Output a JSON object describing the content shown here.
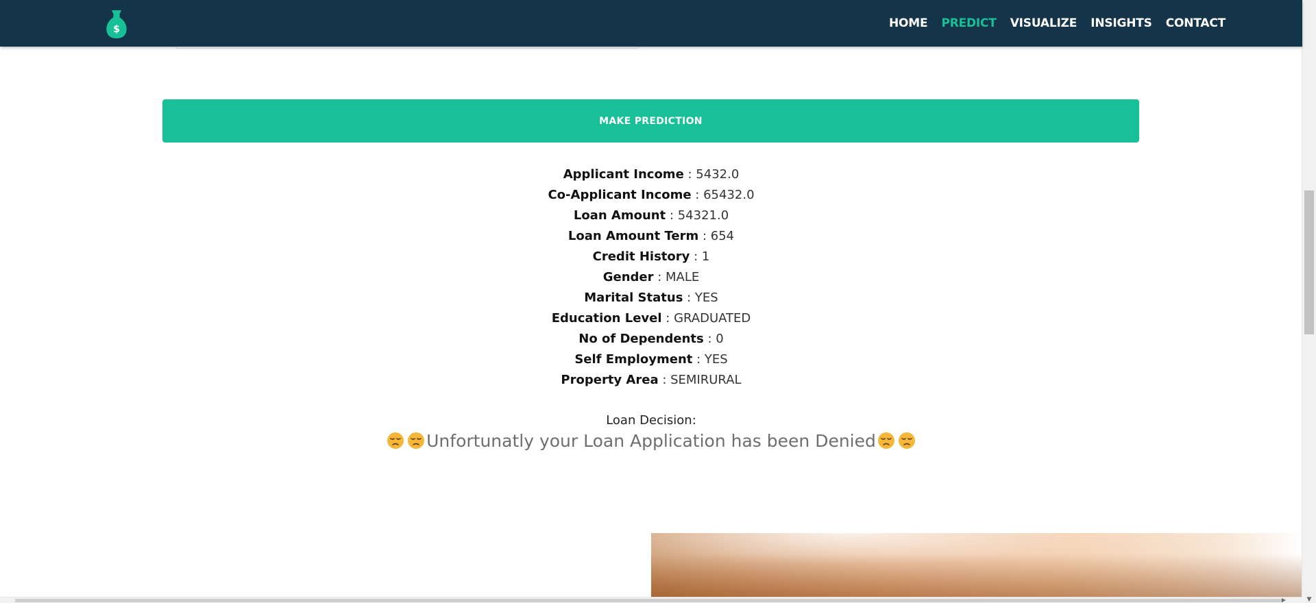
{
  "nav": {
    "items": [
      {
        "label": "HOME",
        "active": false
      },
      {
        "label": "PREDICT",
        "active": true
      },
      {
        "label": "VISUALIZE",
        "active": false
      },
      {
        "label": "INSIGHTS",
        "active": false
      },
      {
        "label": "CONTACT",
        "active": false
      }
    ]
  },
  "predict_button": {
    "label": "MAKE PREDICTION"
  },
  "results": [
    {
      "label": "Applicant Income",
      "sep": " : ",
      "value": "5432.0"
    },
    {
      "label": "Co-Applicant Income",
      "sep": " : ",
      "value": "65432.0"
    },
    {
      "label": "Loan Amount",
      "sep": " : ",
      "value": "54321.0"
    },
    {
      "label": "Loan Amount Term",
      "sep": " : ",
      "value": "654"
    },
    {
      "label": "Credit History",
      "sep": " : ",
      "value": "1"
    },
    {
      "label": "Gender",
      "sep": " : ",
      "value": "MALE"
    },
    {
      "label": "Marital Status",
      "sep": " : ",
      "value": "YES"
    },
    {
      "label": "Education Level",
      "sep": " : ",
      "value": "GRADUATED"
    },
    {
      "label": "No of Dependents",
      "sep": " : ",
      "value": "0"
    },
    {
      "label": "Self Employment",
      "sep": " : ",
      "value": "YES"
    },
    {
      "label": "Property Area",
      "sep": " : ",
      "value": "SEMIRURAL"
    }
  ],
  "decision": {
    "label": "Loan Decision:",
    "message": "Unfortunatly your Loan Application has been Denied",
    "emoji": "pensive-face"
  },
  "colors": {
    "navbar": "#14344a",
    "accent": "#17c096",
    "active_nav": "#19bf97"
  },
  "icons": {
    "logo": "money-bag-icon",
    "emoji": "pensive-face-icon"
  }
}
